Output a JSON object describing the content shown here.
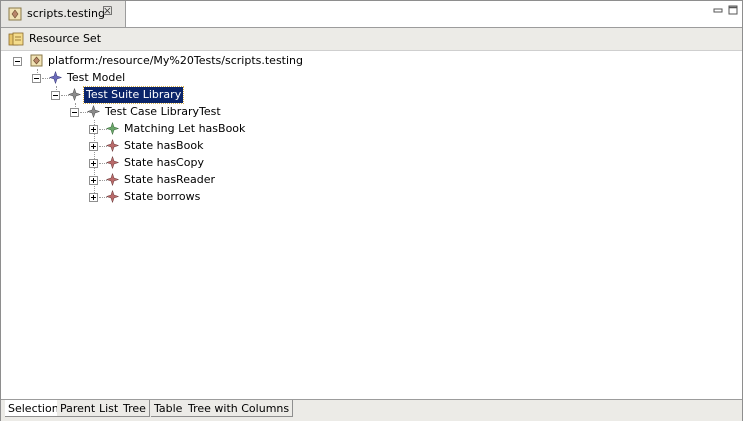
{
  "editor_tab": {
    "title": "scripts.testing",
    "close_glyph": "☒",
    "icon": "testing-file-icon"
  },
  "toolbar": {
    "label": "Resource Set",
    "icon": "resource-set-icon"
  },
  "tree": {
    "root": "platform:/resource/My%20Tests/scripts.testing",
    "test_model": "Test Model",
    "test_suite": "Test Suite Library",
    "test_case": "Test Case LibraryTest",
    "children": [
      "Matching Let hasBook",
      "State hasBook",
      "State hasCopy",
      "State hasReader",
      "State borrows"
    ]
  },
  "bottom_tabs": [
    "Selection",
    "Parent",
    "List",
    "Tree",
    "Table",
    "Tree with Columns"
  ],
  "active_bottom_tab": "Selection",
  "colors": {
    "selection_bg": "#0a246a",
    "node_blue": "#6a6ab8",
    "node_green": "#6aa56a",
    "node_red": "#b86a6a"
  }
}
